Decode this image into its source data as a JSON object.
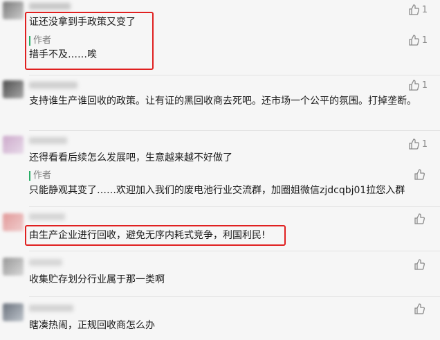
{
  "comments": [
    {
      "text": "证还没拿到手政策又变了",
      "likes": "1",
      "reply": {
        "author_label": "作者",
        "text": "措手不及……唉",
        "likes": "1"
      }
    },
    {
      "text": "支持谁生产谁回收的政策。让有证的黑回收商去死吧。还市场一个公平的氛围。打掉垄断。",
      "likes": "1"
    },
    {
      "text": "还得看看后续怎么发展吧，生意越来越不好做了",
      "likes": "1",
      "reply": {
        "author_label": "作者",
        "text": "只能静观其变了……欢迎加入我们的废电池行业交流群，加圈姐微信zjdcqbj01拉您入群",
        "likes": ""
      }
    },
    {
      "text": "由生产企业进行回收，避免无序内耗式竞争，利国利民!",
      "likes": ""
    },
    {
      "text": "收集贮存划分行业属于那一类啊",
      "likes": ""
    },
    {
      "text": "瞎凑热闹，正规回收商怎么办",
      "likes": ""
    }
  ],
  "colors": {
    "highlight": "#e02020",
    "author_bar": "#2aae67"
  },
  "icons": {
    "like": "thumbs-up-icon"
  }
}
